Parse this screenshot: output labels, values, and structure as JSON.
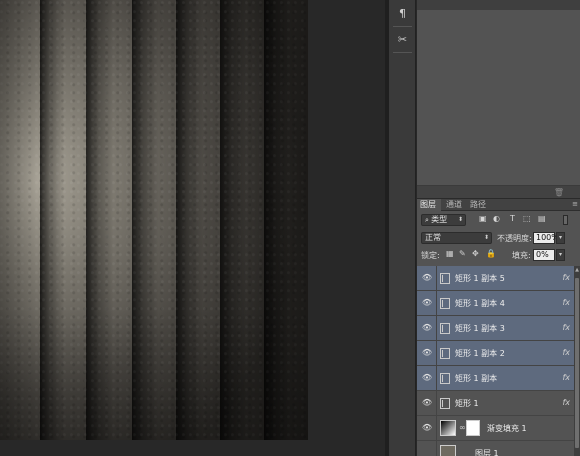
{
  "dock": {
    "paragraph_icon": "¶",
    "tools_icon": "✂"
  },
  "layers_panel": {
    "tabs": [
      "图层",
      "通道",
      "路径"
    ],
    "filter_kind": "类型",
    "filter_icon_names": [
      "image-filter-icon",
      "adjustment-filter-icon",
      "type-filter-icon",
      "shape-filter-icon",
      "smart-object-filter-icon"
    ],
    "blend_mode": "正常",
    "opacity_label": "不透明度:",
    "opacity_value": "100%",
    "lock_label": "锁定:",
    "fill_label": "填充:",
    "fill_value": "0%",
    "layers": [
      {
        "name": "矩形 1 副本 5",
        "type": "shape",
        "fx": "fx",
        "selected": true
      },
      {
        "name": "矩形 1 副本 4",
        "type": "shape",
        "fx": "fx",
        "selected": true
      },
      {
        "name": "矩形 1 副本 3",
        "type": "shape",
        "fx": "fx",
        "selected": true
      },
      {
        "name": "矩形 1 副本 2",
        "type": "shape",
        "fx": "fx",
        "selected": true
      },
      {
        "name": "矩形 1 副本",
        "type": "shape",
        "fx": "fx",
        "selected": true
      },
      {
        "name": "矩形 1",
        "type": "shape",
        "fx": "fx",
        "selected": false
      },
      {
        "name": "渐变填充 1",
        "type": "gradient-fill",
        "fx": "",
        "selected": false
      },
      {
        "name": "图层 1",
        "type": "texture",
        "fx": "",
        "selected": false
      }
    ]
  },
  "colors": {
    "selected_row": "#5e6a7e",
    "panel_bg": "#535353",
    "workspace_bg": "#282828"
  }
}
